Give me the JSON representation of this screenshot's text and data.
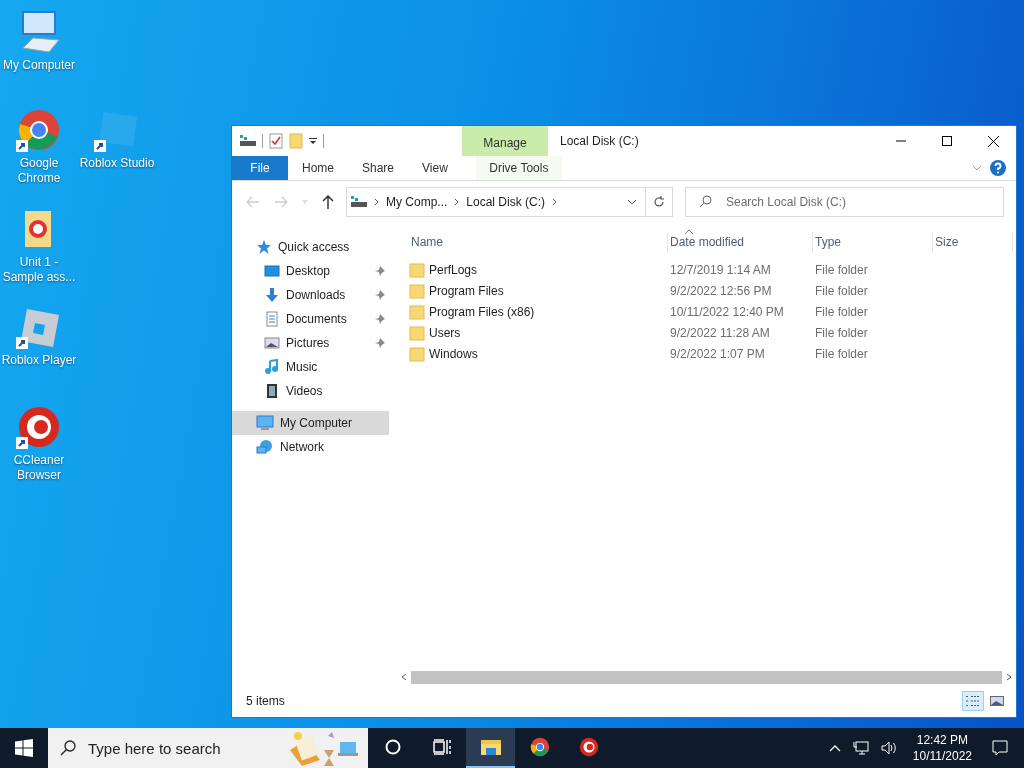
{
  "desktop_icons": [
    {
      "label": "My Computer",
      "shortcut": false
    },
    {
      "label": "Google Chrome",
      "shortcut": true
    },
    {
      "label": "Roblox Studio",
      "shortcut": true
    },
    {
      "label": "Unit 1 - Sample ass...",
      "shortcut": false
    },
    {
      "label": "Roblox Player",
      "shortcut": true
    },
    {
      "label": "CCleaner Browser",
      "shortcut": true
    }
  ],
  "window": {
    "title": "Local Disk (C:)",
    "context_group": "Manage",
    "ribbon_tabs": [
      {
        "label": "File",
        "kind": "file"
      },
      {
        "label": "Home",
        "kind": "tab"
      },
      {
        "label": "Share",
        "kind": "tab"
      },
      {
        "label": "View",
        "kind": "tab"
      },
      {
        "label": "Drive Tools",
        "kind": "contextual"
      }
    ],
    "address": [
      "My Comp...",
      "Local Disk (C:)"
    ],
    "search": {
      "placeholder": "Search Local Disk (C:)"
    },
    "sidebar": [
      {
        "label": "Quick access",
        "selected": false,
        "children": [
          {
            "label": "Desktop",
            "pinned": true
          },
          {
            "label": "Downloads",
            "pinned": true
          },
          {
            "label": "Documents",
            "pinned": true
          },
          {
            "label": "Pictures",
            "pinned": true
          },
          {
            "label": "Music",
            "pinned": false
          },
          {
            "label": "Videos",
            "pinned": false
          }
        ]
      },
      {
        "label": "My Computer",
        "selected": true
      },
      {
        "label": "Network",
        "selected": false
      }
    ],
    "columns": [
      "Name",
      "Date modified",
      "Type",
      "Size"
    ],
    "rows": [
      {
        "name": "PerfLogs",
        "date": "12/7/2019 1:14 AM",
        "type": "File folder"
      },
      {
        "name": "Program Files",
        "date": "9/2/2022 12:56 PM",
        "type": "File folder"
      },
      {
        "name": "Program Files (x86)",
        "date": "10/11/2022 12:40 PM",
        "type": "File folder"
      },
      {
        "name": "Users",
        "date": "9/2/2022 11:28 AM",
        "type": "File folder"
      },
      {
        "name": "Windows",
        "date": "9/2/2022 1:07 PM",
        "type": "File folder"
      }
    ],
    "status": "5 items",
    "views": [
      {
        "kind": "details",
        "selected": true
      },
      {
        "kind": "large",
        "selected": false
      }
    ]
  },
  "taskbar": {
    "search_placeholder": "Type here to search",
    "apps": [
      {
        "kind": "explorer",
        "active": true
      },
      {
        "kind": "chrome",
        "active": false
      },
      {
        "kind": "ccleaner",
        "active": false
      }
    ],
    "time": "12:42 PM",
    "date": "10/11/2022"
  }
}
